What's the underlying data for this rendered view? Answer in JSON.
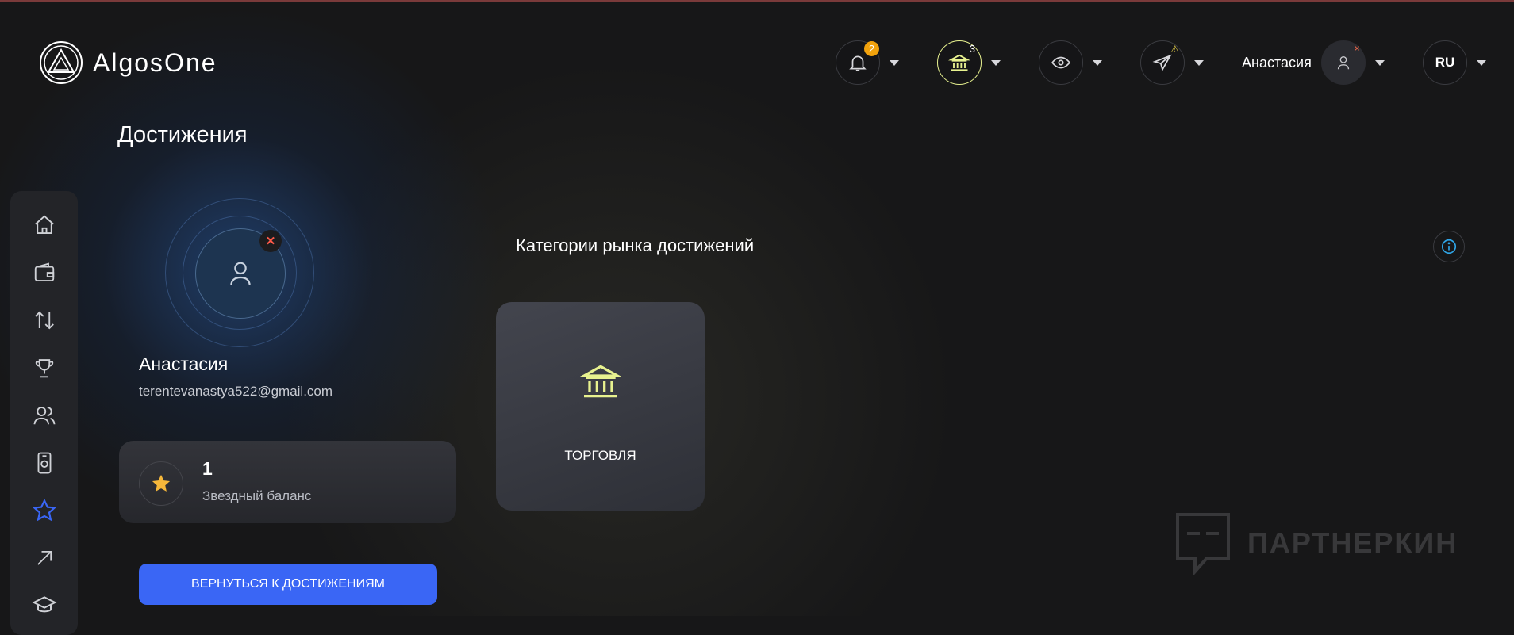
{
  "app": {
    "name": "AlgosOne"
  },
  "header": {
    "notifications": {
      "icon": "bell-icon",
      "badge": "2"
    },
    "bank": {
      "icon": "bank-icon",
      "count": "3"
    },
    "visibility": {
      "icon": "eye-icon"
    },
    "telegram": {
      "icon": "telegram-icon",
      "warning": "⚠"
    },
    "user": {
      "name": "Анастасия",
      "status_mark": "×"
    },
    "language": "RU"
  },
  "sidebar": {
    "items": [
      {
        "icon": "home-icon"
      },
      {
        "icon": "wallet-icon"
      },
      {
        "icon": "transfer-arrows-icon"
      },
      {
        "icon": "trophy-icon"
      },
      {
        "icon": "users-icon"
      },
      {
        "icon": "device-icon"
      },
      {
        "icon": "star-icon",
        "active": true
      },
      {
        "icon": "arrow-up-right-icon"
      },
      {
        "icon": "graduation-cap-icon"
      }
    ]
  },
  "page": {
    "title": "Достижения"
  },
  "profile": {
    "name": "Анастасия",
    "email": "terentevanastya522@gmail.com",
    "remove_mark": "✕"
  },
  "balance": {
    "value": "1",
    "label": "Звездный баланс",
    "icon": "star-icon"
  },
  "back_button": {
    "label": "ВЕРНУТЬСЯ К ДОСТИЖЕНИЯМ"
  },
  "categories": {
    "title": "Категории рынка достижений",
    "items": [
      {
        "label": "ТОРГОВЛЯ",
        "icon": "bank-icon"
      }
    ]
  },
  "watermark": {
    "text": "ПАРТНЕРКИН"
  },
  "colors": {
    "accent": "#3a66f5",
    "badge": "#f2a20c",
    "highlight": "#e8f28f",
    "info": "#2fa6e8"
  }
}
